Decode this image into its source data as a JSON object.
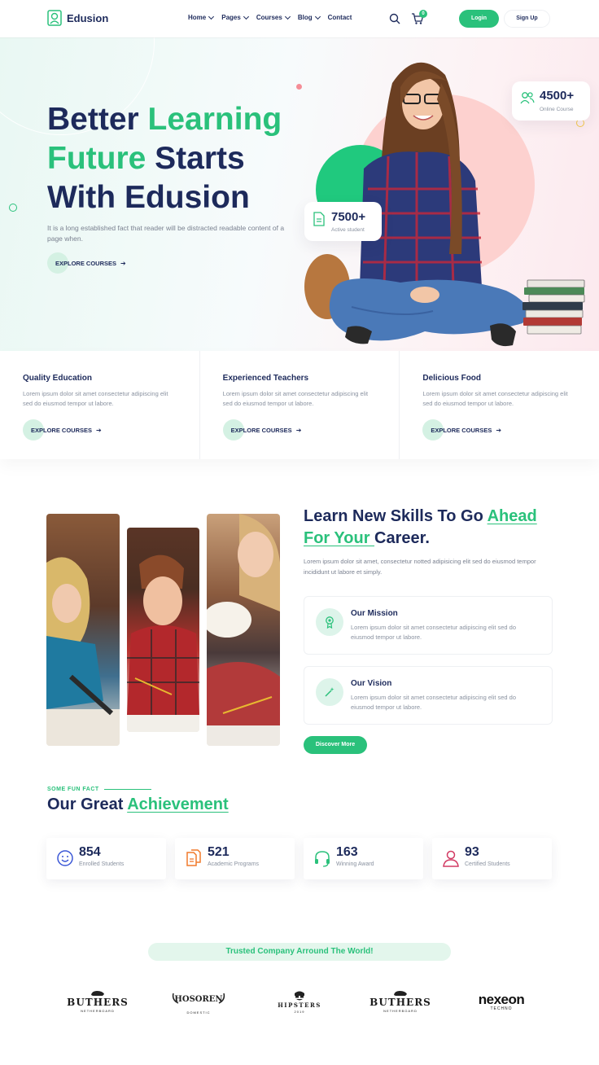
{
  "header": {
    "brand": "Edusion",
    "nav": [
      {
        "label": "Home",
        "dropdown": true
      },
      {
        "label": "Pages",
        "dropdown": true
      },
      {
        "label": "Courses",
        "dropdown": true
      },
      {
        "label": "Blog",
        "dropdown": true
      },
      {
        "label": "Contact",
        "dropdown": false
      }
    ],
    "cart_count": "0",
    "login": "Login",
    "signup": "Sign Up"
  },
  "hero": {
    "title_1": "Better ",
    "title_2": "Learning",
    "title_3": "Future",
    "title_4": " Starts",
    "title_5": "With Edusion",
    "description": "It is a long established fact that reader will be distracted readable content of a page when.",
    "cta": "EXPLORE COURSES",
    "stat_courses": {
      "value": "4500+",
      "label": "Online Course"
    },
    "stat_students": {
      "value": "7500+",
      "label": "Active student"
    }
  },
  "features": [
    {
      "title": "Quality Education",
      "desc": "Lorem ipsum dolor sit amet consectetur adipiscing elit sed do eiusmod tempor ut labore.",
      "cta": "EXPLORE COURSES"
    },
    {
      "title": "Experienced Teachers",
      "desc": "Lorem ipsum dolor sit amet consectetur adipiscing elit sed do eiusmod tempor ut labore.",
      "cta": "EXPLORE COURSES"
    },
    {
      "title": "Delicious Food",
      "desc": "Lorem ipsum dolor sit amet consectetur adipiscing elit sed do eiusmod tempor ut labore.",
      "cta": "EXPLORE COURSES"
    }
  ],
  "about": {
    "title_1": "Learn New Skills To Go ",
    "title_2": "Ahead",
    "title_3": "For Your ",
    "title_4": "Career.",
    "description": "Lorem ipsum dolor sit amet, consectetur notted adipisicing elit sed do eiusmod tempor incididunt ut labore et simply.",
    "mission": {
      "title": "Our Mission",
      "desc": "Lorem ipsum dolor sit amet consectetur adipiscing elit sed do eiusmod tempor ut labore."
    },
    "vision": {
      "title": "Our Vision",
      "desc": "Lorem ipsum dolor sit amet consectetur adipiscing elit sed do eiusmod tempor ut labore."
    },
    "cta": "Discover More"
  },
  "achievement": {
    "eyebrow": "SOME FUN FACT",
    "title_1": "Our Great ",
    "title_2": "Achievement",
    "stats": [
      {
        "value": "854",
        "label": "Enrolled Students",
        "icon": "smile-icon",
        "color": "#3b57d6"
      },
      {
        "value": "521",
        "label": "Academic Programs",
        "icon": "documents-icon",
        "color": "#f07a2c"
      },
      {
        "value": "163",
        "label": "Winning Award",
        "icon": "headset-icon",
        "color": "#2ac17b"
      },
      {
        "value": "93",
        "label": "Certified Students",
        "icon": "user-icon",
        "color": "#d23a63"
      }
    ]
  },
  "trusted": {
    "heading": "Trusted Company Arround The World!",
    "brands": [
      {
        "name": "BUTHERS",
        "sub": "NETHERBOARD"
      },
      {
        "name": "HOSOREN",
        "sub": "DOMESTIC"
      },
      {
        "name": "HIPSTERS",
        "sub": "2019"
      },
      {
        "name": "BUTHERS",
        "sub": "NETHERBOARD"
      },
      {
        "name": "nexeon",
        "sub": "TECHNO"
      }
    ]
  },
  "colors": {
    "primary": "#2ac17b",
    "navy": "#1d2a5b",
    "pink": "#fdd1cf"
  }
}
